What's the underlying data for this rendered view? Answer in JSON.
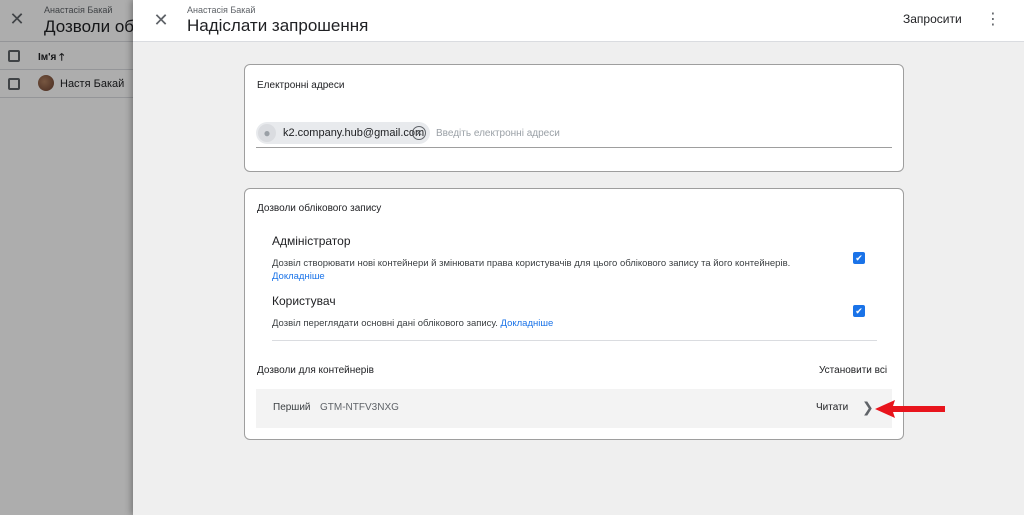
{
  "background": {
    "account": "Анастасія Бакай",
    "title": "Дозволи облі",
    "column_name": "Ім'я",
    "sort_icon": "arrow-up-icon",
    "user_name": "Настя Бакай"
  },
  "dialog": {
    "account": "Анастасія Бакай",
    "title": "Надіслати запрошення",
    "invite_label": "Запросити",
    "close_icon": "close-icon",
    "more_icon": "more-vert-icon"
  },
  "emails": {
    "label": "Електронні адреси",
    "chip": "k2.company.hub@gmail.com",
    "placeholder": "Введіть електронні адреси"
  },
  "permissions": {
    "label": "Дозволи облікового запису",
    "roles": [
      {
        "title": "Адміністратор",
        "description": "Дозвіл створювати нові контейнери й змінювати права користувачів для цього облікового запису та його контейнерів.",
        "learn_more": "Докладніше",
        "checked": true
      },
      {
        "title": "Користувач",
        "description": "Дозвіл переглядати основні дані облікового запису.",
        "learn_more": "Докладніше",
        "checked": true
      }
    ]
  },
  "containers": {
    "label": "Дозволи для контейнерів",
    "set_all": "Установити всі",
    "items": [
      {
        "name": "Перший",
        "id": "GTM-NTFV3NXG",
        "access": "Читати"
      }
    ]
  },
  "colors": {
    "accent": "#1a73e8",
    "annotation_arrow": "#e8141c"
  }
}
